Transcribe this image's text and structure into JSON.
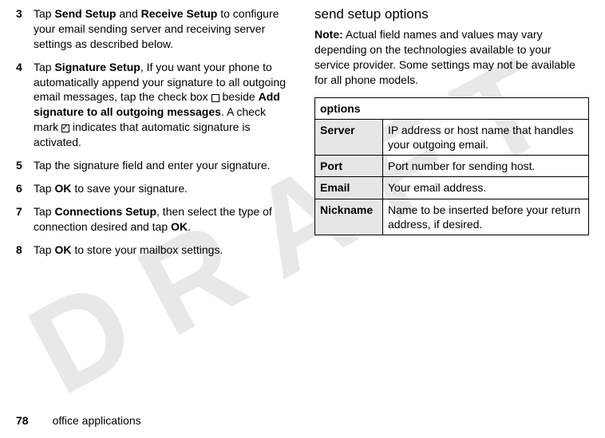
{
  "watermark": "DRAFT",
  "left_col": {
    "steps": [
      {
        "num": "3",
        "prefix": "Tap ",
        "b1": "Send Setup",
        "mid1": " and ",
        "b2": "Receive Setup",
        "rest": " to configure your email sending server and receiving server settings as described below."
      },
      {
        "num": "4",
        "prefix": "Tap ",
        "b1": "Signature Setup",
        "mid1": ", If you want your phone to automatically append your signature to all outgoing email messages, tap the check box ",
        "cb1": true,
        "mid2": " beside ",
        "b2": "Add signature to all outgoing messages",
        "mid3": ". A check mark ",
        "cb2": true,
        "rest": " indicates that automatic signature is activated."
      },
      {
        "num": "5",
        "text": "Tap the signature field and enter your signature."
      },
      {
        "num": "6",
        "prefix": "Tap ",
        "b1": "OK",
        "rest": " to save your signature."
      },
      {
        "num": "7",
        "prefix": "Tap ",
        "b1": "Connections Setup",
        "mid1": ", then select the type of connection desired and tap ",
        "b2": "OK",
        "rest": "."
      },
      {
        "num": "8",
        "prefix": "Tap ",
        "b1": "OK",
        "rest": " to store your mailbox settings."
      }
    ]
  },
  "right_col": {
    "heading": "send setup options",
    "note_label": "Note:",
    "note_text": " Actual field names and values may vary depending on the technologies available to your service provider. Some settings may not be available for all phone models.",
    "table": {
      "header": "options",
      "rows": [
        {
          "label": "Server",
          "desc": "IP address or host name that handles your outgoing email."
        },
        {
          "label": "Port",
          "desc": "Port number for sending host."
        },
        {
          "label": "Email",
          "desc": "Your email address."
        },
        {
          "label": "Nickname",
          "desc": "Name to be inserted before your return address, if desired."
        }
      ]
    }
  },
  "footer": {
    "page": "78",
    "section": "office applications"
  }
}
